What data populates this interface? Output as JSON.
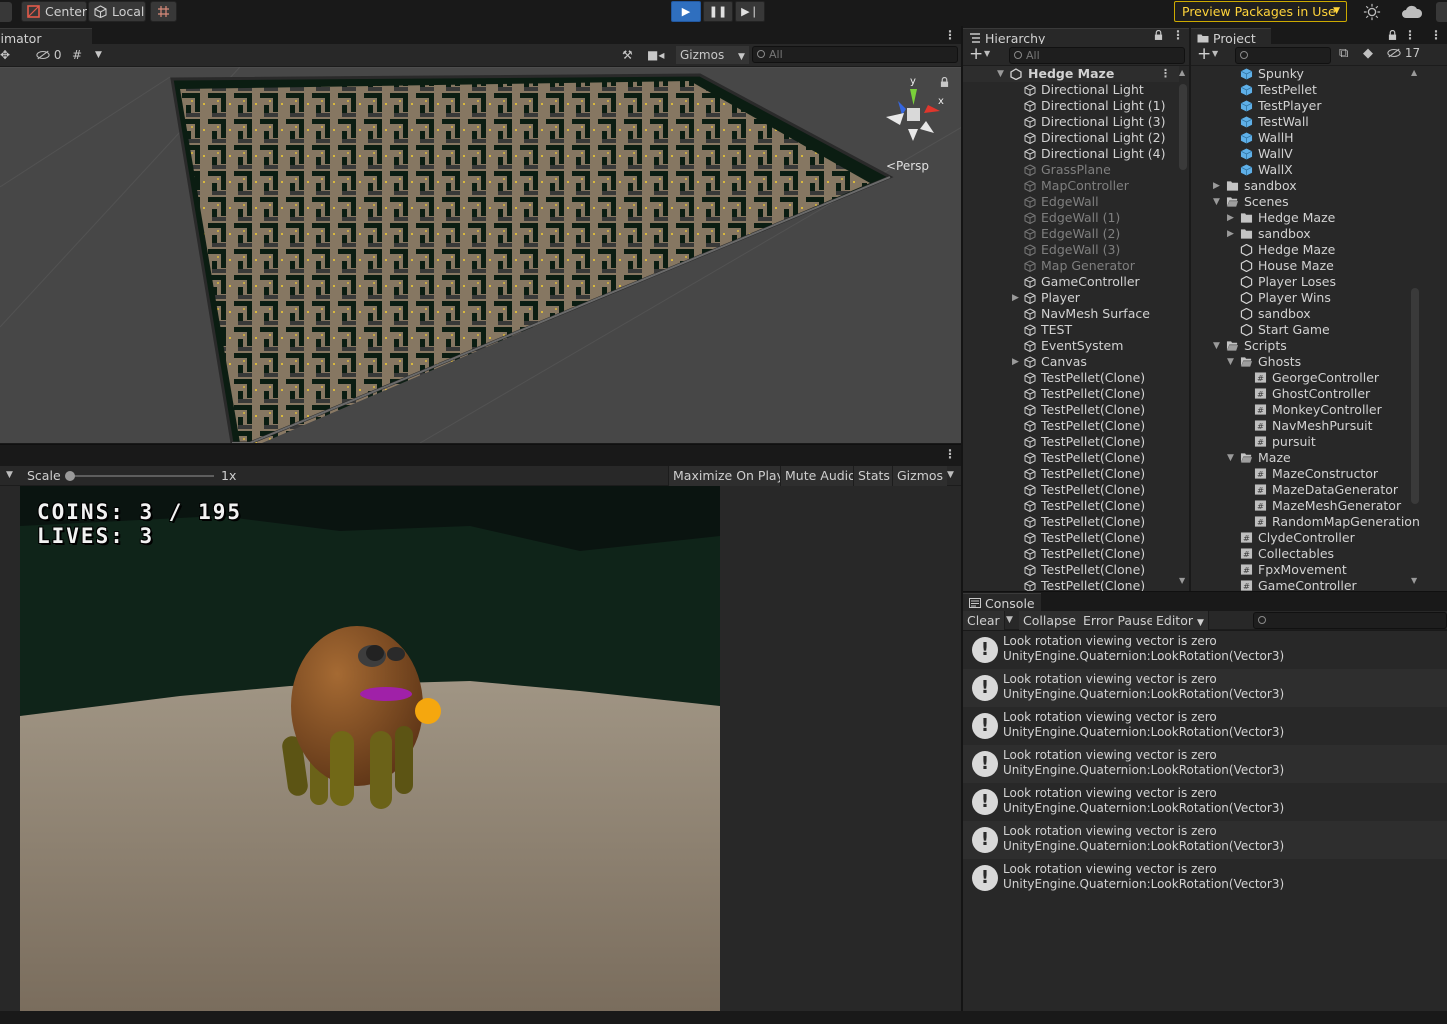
{
  "toolbar": {
    "center_label": "Center",
    "local_label": "Local",
    "preview_packages": "Preview Packages in Use"
  },
  "scene_panel": {
    "tab_label": "Animator",
    "visibility_count": "0",
    "gizmos_label": "Gizmos",
    "search_placeholder": "All",
    "persp_label": "<Persp",
    "gizmo_axes": [
      "y",
      "x"
    ]
  },
  "game_panel": {
    "scale_label": "Scale",
    "scale_value": "1x",
    "buttons": [
      "Maximize On Play",
      "Mute Audio",
      "Stats",
      "Gizmos"
    ],
    "hud": {
      "coins": "COINS: 3 / 195",
      "lives": "LIVES: 3"
    }
  },
  "hierarchy": {
    "tab_label": "Hierarchy",
    "search_placeholder": "All",
    "scene_name": "Hedge Maze",
    "items": [
      {
        "label": "Directional Light",
        "dim": false,
        "expandable": false
      },
      {
        "label": "Directional Light (1)",
        "dim": false,
        "expandable": false
      },
      {
        "label": "Directional Light (3)",
        "dim": false,
        "expandable": false
      },
      {
        "label": "Directional Light (2)",
        "dim": false,
        "expandable": false
      },
      {
        "label": "Directional Light (4)",
        "dim": false,
        "expandable": false
      },
      {
        "label": "GrassPlane",
        "dim": true,
        "expandable": false
      },
      {
        "label": "MapController",
        "dim": true,
        "expandable": false
      },
      {
        "label": "EdgeWall",
        "dim": true,
        "expandable": false
      },
      {
        "label": "EdgeWall (1)",
        "dim": true,
        "expandable": false
      },
      {
        "label": "EdgeWall (2)",
        "dim": true,
        "expandable": false
      },
      {
        "label": "EdgeWall (3)",
        "dim": true,
        "expandable": false
      },
      {
        "label": "Map Generator",
        "dim": true,
        "expandable": false
      },
      {
        "label": "GameController",
        "dim": false,
        "expandable": false
      },
      {
        "label": "Player",
        "dim": false,
        "expandable": true
      },
      {
        "label": "NavMesh Surface",
        "dim": false,
        "expandable": false
      },
      {
        "label": "TEST",
        "dim": false,
        "expandable": false
      },
      {
        "label": "EventSystem",
        "dim": false,
        "expandable": false
      },
      {
        "label": "Canvas",
        "dim": false,
        "expandable": true
      },
      {
        "label": "TestPellet(Clone)",
        "dim": false,
        "expandable": false
      },
      {
        "label": "TestPellet(Clone)",
        "dim": false,
        "expandable": false
      },
      {
        "label": "TestPellet(Clone)",
        "dim": false,
        "expandable": false
      },
      {
        "label": "TestPellet(Clone)",
        "dim": false,
        "expandable": false
      },
      {
        "label": "TestPellet(Clone)",
        "dim": false,
        "expandable": false
      },
      {
        "label": "TestPellet(Clone)",
        "dim": false,
        "expandable": false
      },
      {
        "label": "TestPellet(Clone)",
        "dim": false,
        "expandable": false
      },
      {
        "label": "TestPellet(Clone)",
        "dim": false,
        "expandable": false
      },
      {
        "label": "TestPellet(Clone)",
        "dim": false,
        "expandable": false
      },
      {
        "label": "TestPellet(Clone)",
        "dim": false,
        "expandable": false
      },
      {
        "label": "TestPellet(Clone)",
        "dim": false,
        "expandable": false
      },
      {
        "label": "TestPellet(Clone)",
        "dim": false,
        "expandable": false
      },
      {
        "label": "TestPellet(Clone)",
        "dim": false,
        "expandable": false
      },
      {
        "label": "TestPellet(Clone)",
        "dim": false,
        "expandable": false
      }
    ]
  },
  "project": {
    "tab_label": "Project",
    "hidden_count": "17",
    "items": [
      {
        "label": "Spunky",
        "kind": "prefab",
        "depth": 2,
        "arrow": ""
      },
      {
        "label": "TestPellet",
        "kind": "prefab",
        "depth": 2,
        "arrow": ""
      },
      {
        "label": "TestPlayer",
        "kind": "prefab",
        "depth": 2,
        "arrow": ""
      },
      {
        "label": "TestWall",
        "kind": "prefab",
        "depth": 2,
        "arrow": ""
      },
      {
        "label": "WallH",
        "kind": "prefab",
        "depth": 2,
        "arrow": ""
      },
      {
        "label": "WallV",
        "kind": "prefab",
        "depth": 2,
        "arrow": ""
      },
      {
        "label": "WallX",
        "kind": "prefab",
        "depth": 2,
        "arrow": ""
      },
      {
        "label": "sandbox",
        "kind": "folder",
        "depth": 1,
        "arrow": "right"
      },
      {
        "label": "Scenes",
        "kind": "folder-open",
        "depth": 1,
        "arrow": "down"
      },
      {
        "label": "Hedge Maze",
        "kind": "folder",
        "depth": 2,
        "arrow": "right"
      },
      {
        "label": "sandbox",
        "kind": "folder",
        "depth": 2,
        "arrow": "right"
      },
      {
        "label": "Hedge Maze",
        "kind": "scene",
        "depth": 2,
        "arrow": ""
      },
      {
        "label": "House Maze",
        "kind": "scene",
        "depth": 2,
        "arrow": ""
      },
      {
        "label": "Player Loses",
        "kind": "scene",
        "depth": 2,
        "arrow": ""
      },
      {
        "label": "Player Wins",
        "kind": "scene",
        "depth": 2,
        "arrow": ""
      },
      {
        "label": "sandbox",
        "kind": "scene",
        "depth": 2,
        "arrow": ""
      },
      {
        "label": "Start Game",
        "kind": "scene",
        "depth": 2,
        "arrow": ""
      },
      {
        "label": "Scripts",
        "kind": "folder-open",
        "depth": 1,
        "arrow": "down"
      },
      {
        "label": "Ghosts",
        "kind": "folder-open",
        "depth": 2,
        "arrow": "down"
      },
      {
        "label": "GeorgeController",
        "kind": "script",
        "depth": 3,
        "arrow": ""
      },
      {
        "label": "GhostController",
        "kind": "script",
        "depth": 3,
        "arrow": ""
      },
      {
        "label": "MonkeyController",
        "kind": "script",
        "depth": 3,
        "arrow": ""
      },
      {
        "label": "NavMeshPursuit",
        "kind": "script",
        "depth": 3,
        "arrow": ""
      },
      {
        "label": "pursuit",
        "kind": "script",
        "depth": 3,
        "arrow": ""
      },
      {
        "label": "Maze",
        "kind": "folder-open",
        "depth": 2,
        "arrow": "down"
      },
      {
        "label": "MazeConstructor",
        "kind": "script",
        "depth": 3,
        "arrow": ""
      },
      {
        "label": "MazeDataGenerator",
        "kind": "script",
        "depth": 3,
        "arrow": ""
      },
      {
        "label": "MazeMeshGenerator",
        "kind": "script",
        "depth": 3,
        "arrow": ""
      },
      {
        "label": "RandomMapGeneration",
        "kind": "script",
        "depth": 3,
        "arrow": ""
      },
      {
        "label": "ClydeController",
        "kind": "script",
        "depth": 2,
        "arrow": ""
      },
      {
        "label": "Collectables",
        "kind": "script",
        "depth": 2,
        "arrow": ""
      },
      {
        "label": "FpxMovement",
        "kind": "script",
        "depth": 2,
        "arrow": ""
      },
      {
        "label": "GameController",
        "kind": "script",
        "depth": 2,
        "arrow": ""
      }
    ]
  },
  "console": {
    "tab_label": "Console",
    "buttons": {
      "clear": "Clear",
      "collapse": "Collapse",
      "error_pause": "Error Pause",
      "editor": "Editor"
    },
    "messages": [
      {
        "line1": "Look rotation viewing vector is zero",
        "line2": "UnityEngine.Quaternion:LookRotation(Vector3)"
      },
      {
        "line1": "Look rotation viewing vector is zero",
        "line2": "UnityEngine.Quaternion:LookRotation(Vector3)"
      },
      {
        "line1": "Look rotation viewing vector is zero",
        "line2": "UnityEngine.Quaternion:LookRotation(Vector3)"
      },
      {
        "line1": "Look rotation viewing vector is zero",
        "line2": "UnityEngine.Quaternion:LookRotation(Vector3)"
      },
      {
        "line1": "Look rotation viewing vector is zero",
        "line2": "UnityEngine.Quaternion:LookRotation(Vector3)"
      },
      {
        "line1": "Look rotation viewing vector is zero",
        "line2": "UnityEngine.Quaternion:LookRotation(Vector3)"
      },
      {
        "line1": "Look rotation viewing vector is zero",
        "line2": "UnityEngine.Quaternion:LookRotation(Vector3)"
      }
    ]
  },
  "colors": {
    "accent_play": "#2f6fbf",
    "preview_warning": "#ffd43b",
    "hedge": "#0b1d12",
    "ground": "#8c7c66"
  }
}
